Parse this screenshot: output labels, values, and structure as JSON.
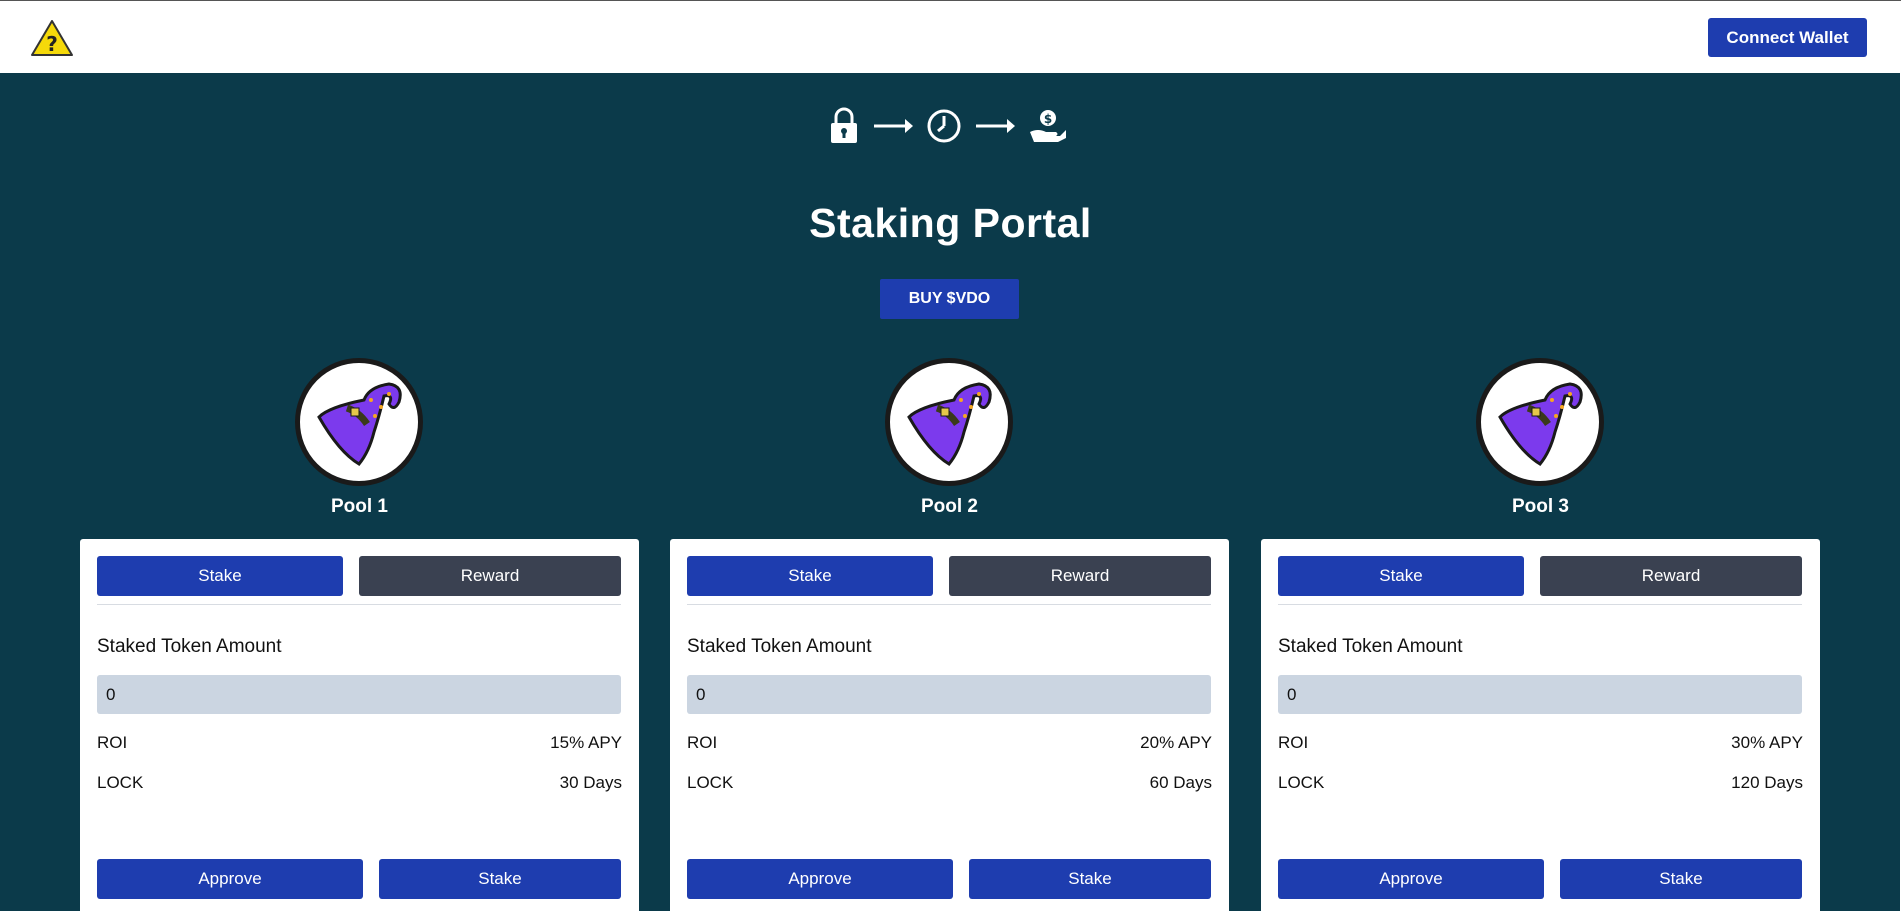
{
  "header": {
    "logo_icon": "warning-question-icon",
    "connect_label": "Connect Wallet"
  },
  "steps": {
    "icons": [
      "lock-icon",
      "arrow-right-icon",
      "clock-icon",
      "arrow-right-icon",
      "hand-money-icon"
    ]
  },
  "main": {
    "title": "Staking Portal",
    "buy_label": "BUY $VDO"
  },
  "pools": [
    {
      "name": "Pool 1",
      "tab_stake": "Stake",
      "tab_reward": "Reward",
      "amount_label": "Staked Token Amount",
      "amount_value": "0",
      "roi_label": "ROI",
      "roi_value": "15% APY",
      "lock_label": "LOCK",
      "lock_value": "30 Days",
      "approve_label": "Approve",
      "stake_label": "Stake"
    },
    {
      "name": "Pool 2",
      "tab_stake": "Stake",
      "tab_reward": "Reward",
      "amount_label": "Staked Token Amount",
      "amount_value": "0",
      "roi_label": "ROI",
      "roi_value": "20% APY",
      "lock_label": "LOCK",
      "lock_value": "60 Days",
      "approve_label": "Approve",
      "stake_label": "Stake"
    },
    {
      "name": "Pool 3",
      "tab_stake": "Stake",
      "tab_reward": "Reward",
      "amount_label": "Staked Token Amount",
      "amount_value": "0",
      "roi_label": "ROI",
      "roi_value": "30% APY",
      "lock_label": "LOCK",
      "lock_value": "120 Days",
      "approve_label": "Approve",
      "stake_label": "Stake"
    }
  ],
  "colors": {
    "background": "#0b3a4a",
    "primary": "#1e3daf",
    "secondary": "#3a4151",
    "input_bg": "#cbd5e1",
    "hat": "#7c3aed"
  }
}
